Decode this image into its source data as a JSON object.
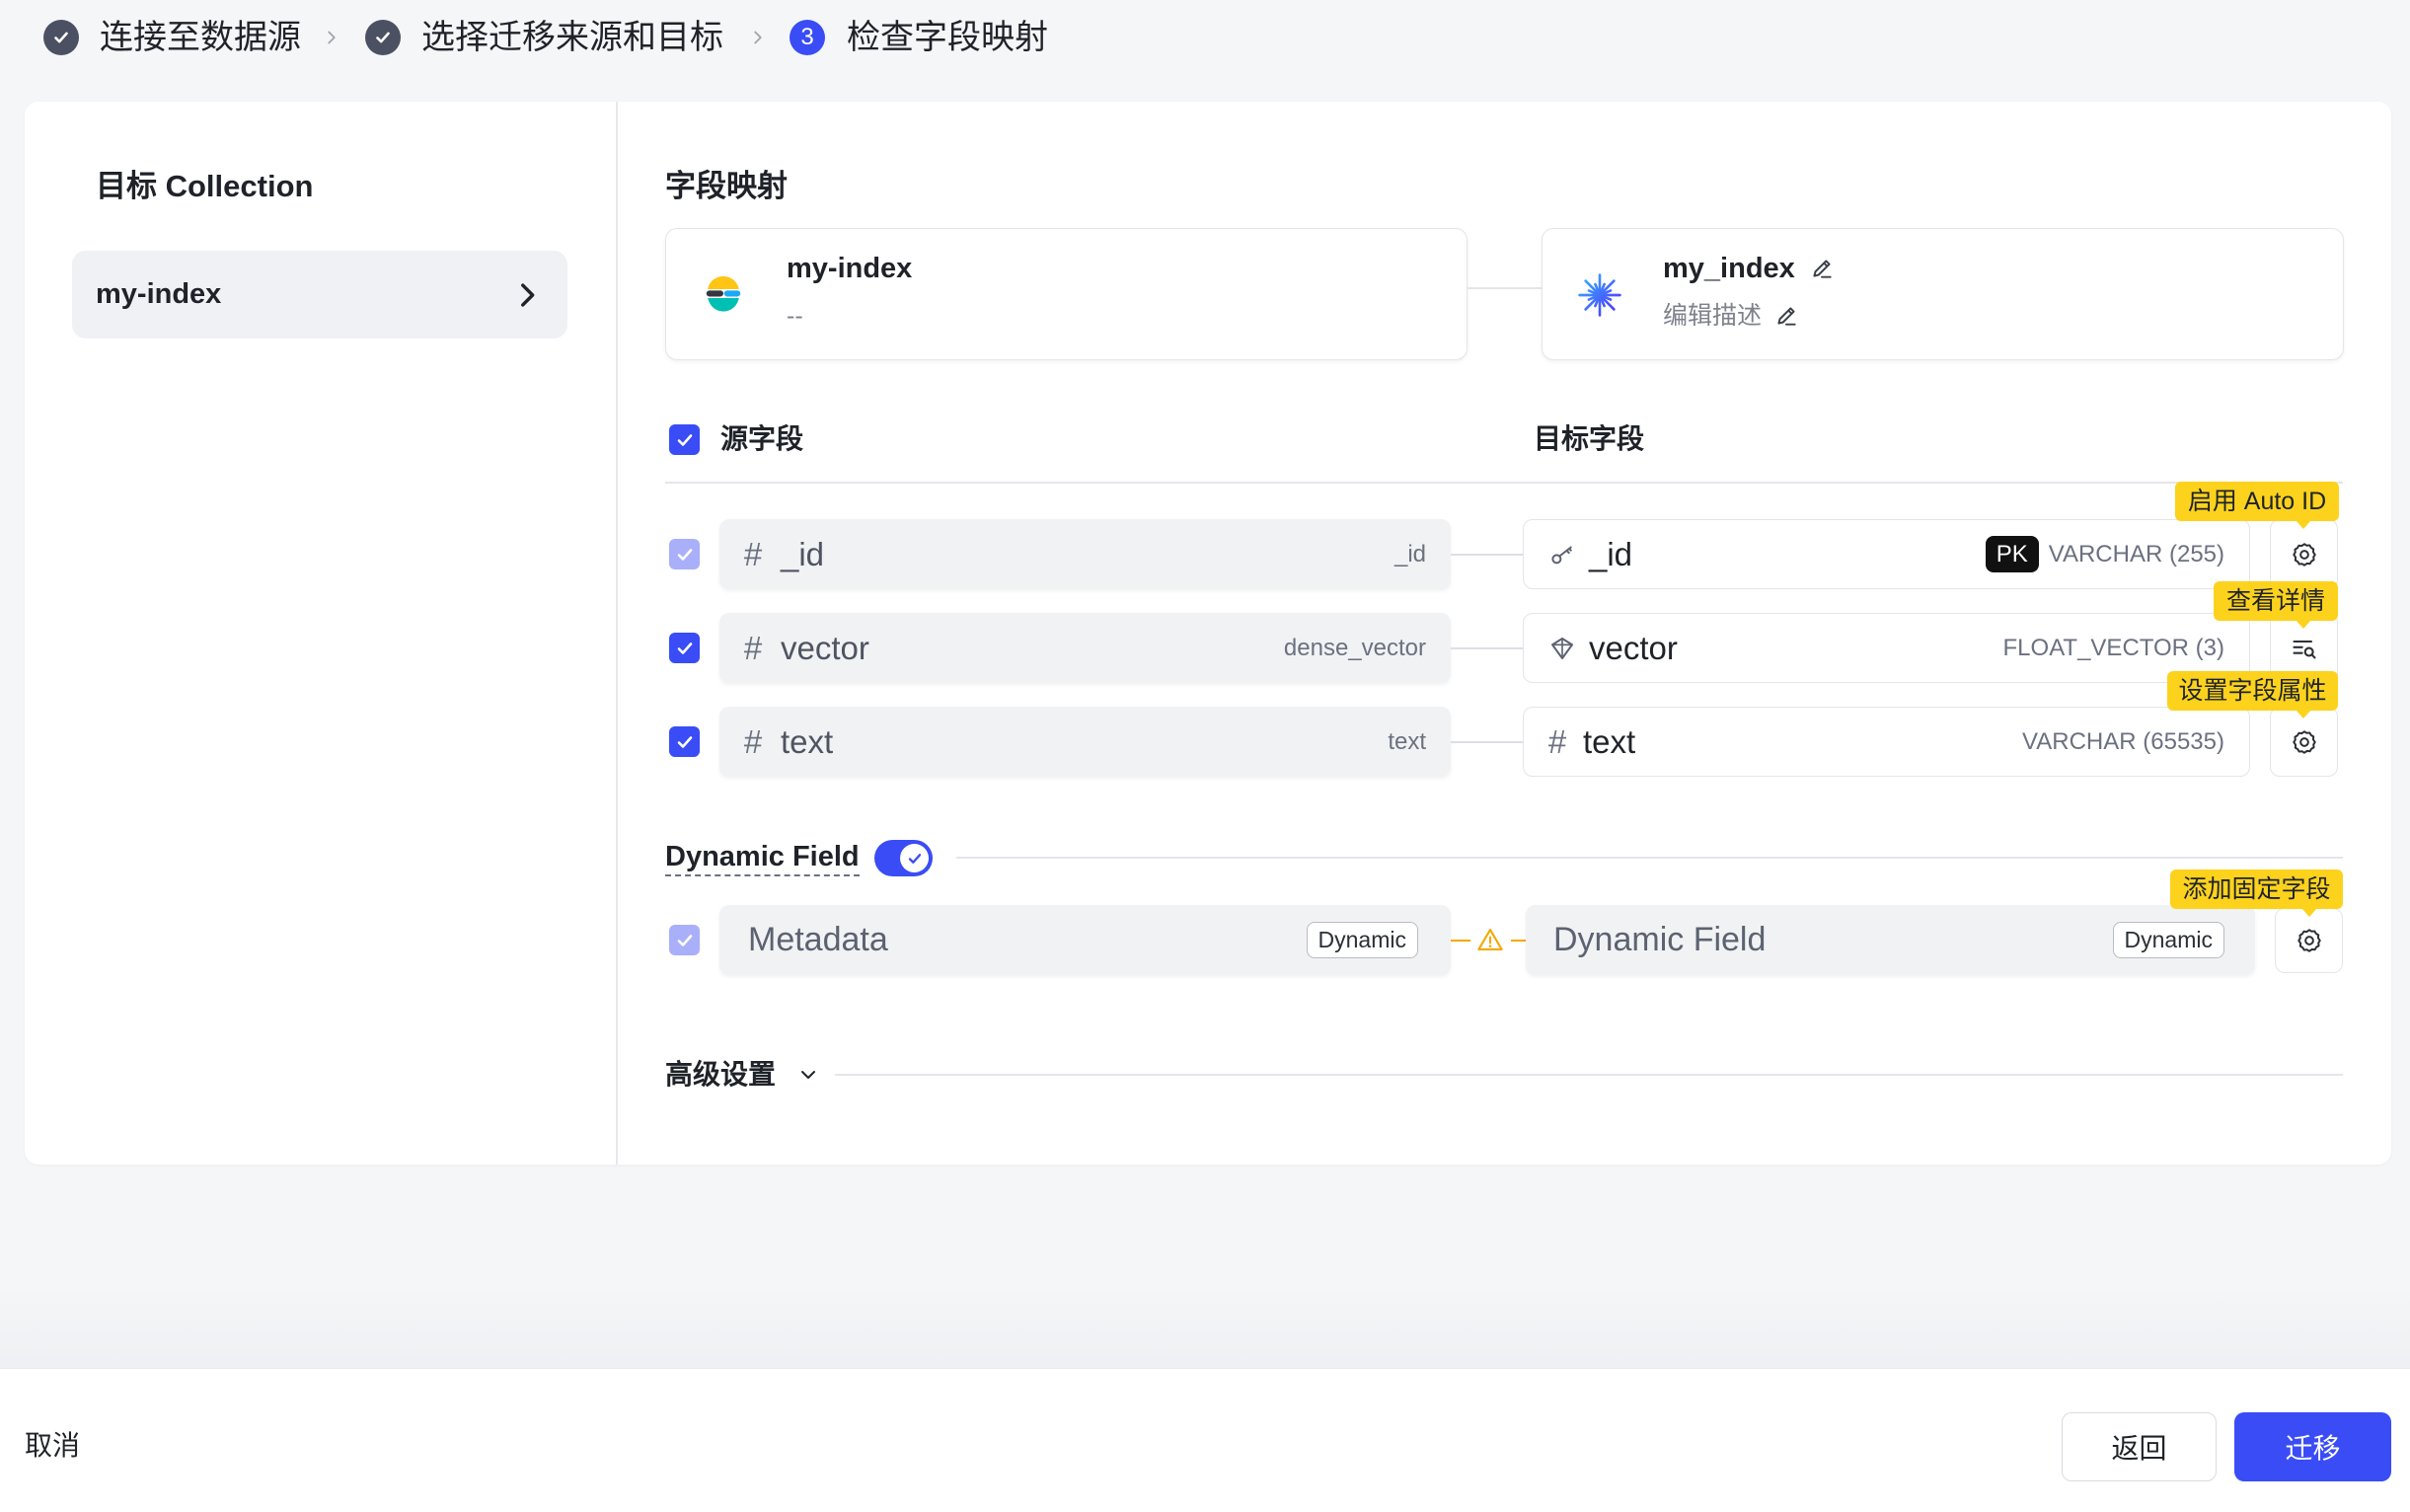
{
  "stepper": {
    "steps": [
      {
        "label": "连接至数据源",
        "status": "done",
        "icon": "check-icon"
      },
      {
        "label": "选择迁移来源和目标",
        "status": "done",
        "icon": "check-icon"
      },
      {
        "label": "检查字段映射",
        "status": "current",
        "number": "3"
      }
    ],
    "separator_icon": "chevron-right-icon"
  },
  "sidebar": {
    "title": "目标 Collection",
    "items": [
      {
        "label": "my-index",
        "selected": true,
        "icon": "chevron-right-icon"
      }
    ]
  },
  "mapping": {
    "title": "字段映射",
    "source": {
      "name": "my-index",
      "description": "--",
      "icon": "elasticsearch-logo-icon"
    },
    "target": {
      "name": "my_index",
      "description": "编辑描述",
      "icon": "milvus-logo-icon",
      "edit_icon": "pencil-icon"
    },
    "header": {
      "select_all_checked": true,
      "source_label": "源字段",
      "target_label": "目标字段"
    },
    "rows": [
      {
        "checked": true,
        "disabled": true,
        "source_icon": "hash-icon",
        "source_name": "_id",
        "source_type": "_id",
        "target_icon": "key-icon",
        "target_name": "_id",
        "target_badge": "PK",
        "target_type": "VARCHAR (255)",
        "action_icon": "gear-icon",
        "tooltip": "启用 Auto ID"
      },
      {
        "checked": true,
        "disabled": false,
        "source_icon": "hash-icon",
        "source_name": "vector",
        "source_type": "dense_vector",
        "target_icon": "vector-icon",
        "target_name": "vector",
        "target_type": "FLOAT_VECTOR (3)",
        "action_icon": "list-search-icon",
        "tooltip": "查看详情"
      },
      {
        "checked": true,
        "disabled": false,
        "source_icon": "hash-icon",
        "source_name": "text",
        "source_type": "text",
        "target_icon": "hash-icon",
        "target_name": "text",
        "target_type": "VARCHAR (65535)",
        "action_icon": "gear-icon",
        "tooltip": "设置字段属性"
      }
    ],
    "dynamic": {
      "label": "Dynamic Field",
      "enabled": true,
      "checked": true,
      "disabled": true,
      "source_name": "Metadata",
      "source_tag": "Dynamic",
      "warning_icon": "warning-icon",
      "target_name": "Dynamic Field",
      "target_tag": "Dynamic",
      "action_icon": "gear-icon",
      "tooltip": "添加固定字段"
    },
    "advanced": {
      "label": "高级设置",
      "icon": "chevron-down-icon",
      "expanded": false
    }
  },
  "footer": {
    "cancel_label": "取消",
    "back_label": "返回",
    "migrate_label": "迁移"
  },
  "colors": {
    "accent": "#3a4cf6",
    "checkbox_disabled": "#a9aff9",
    "step_done": "#4b5162",
    "tooltip": "#fcd21d",
    "warning": "#f2a900",
    "pk_badge": "#111111",
    "page_bg": "#f5f6f8"
  }
}
